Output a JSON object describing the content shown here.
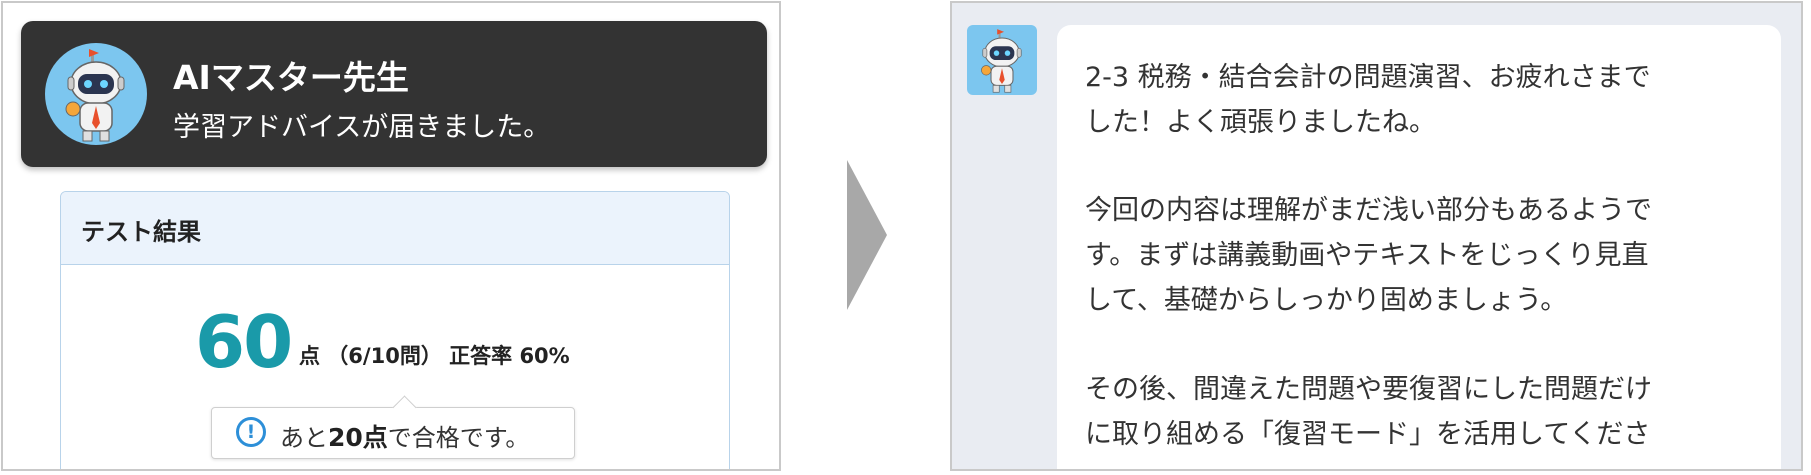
{
  "toast": {
    "title": "AIマスター先生",
    "message": "学習アドバイスが届きました。"
  },
  "test_result": {
    "header": "テスト結果",
    "score": "60",
    "detail": "点 （6/10問） 正答率 60%",
    "notice": {
      "prefix": "あと",
      "emphasis": "20点",
      "suffix": "で合格です。",
      "icon": "info-icon"
    }
  },
  "chat": {
    "lines": [
      "2-3 税務・結合会計の問題演習、お疲れさまで",
      "した！よく頑張りましたね。",
      "今回の内容は理解がまだ浅い部分もあるようで",
      "す。まずは講義動画やテキストをじっくり見直",
      "して、基礎からしっかり固めましょう。",
      "その後、間違えた問題や要復習にした問題だけ",
      "に取り組める「復習モード」を活用してくださ"
    ]
  },
  "colors": {
    "toast_bg": "#333333",
    "score": "#1a9aa9",
    "info": "#2d8fd8",
    "card_header_bg": "#ebf3fc",
    "chat_bg": "#e9ecf2",
    "avatar_bg": "#7cc6ef"
  }
}
